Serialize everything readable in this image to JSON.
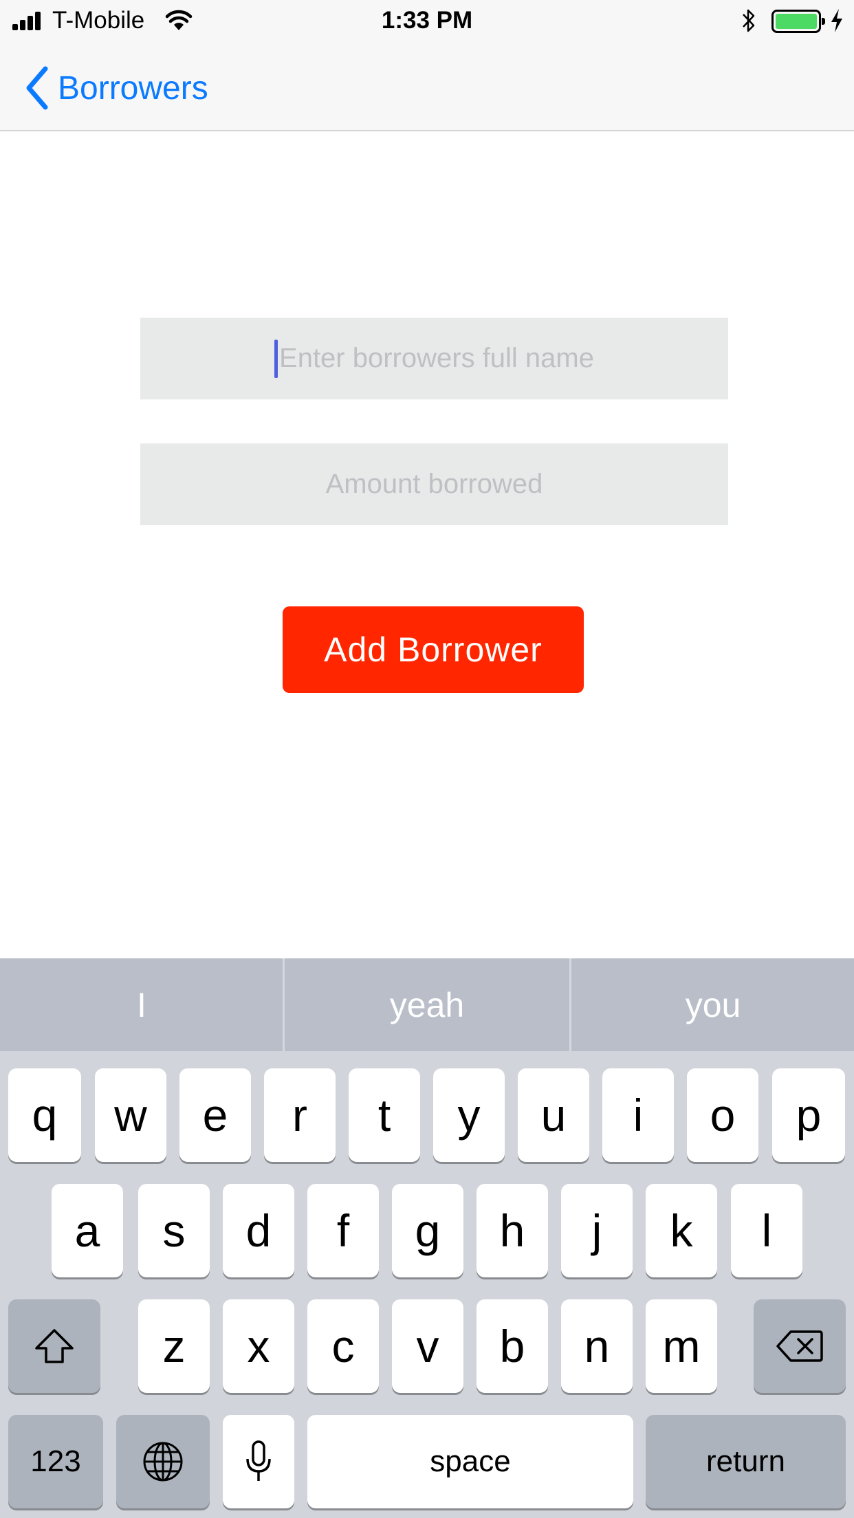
{
  "status_bar": {
    "carrier": "T-Mobile",
    "time": "1:33 PM"
  },
  "nav": {
    "back_label": "Borrowers"
  },
  "form": {
    "name_placeholder": "Enter borrowers full name",
    "amount_placeholder": "Amount borrowed",
    "submit_label": "Add Borrower"
  },
  "keyboard": {
    "suggestions": [
      "I",
      "yeah",
      "you"
    ],
    "row1": [
      "q",
      "w",
      "e",
      "r",
      "t",
      "y",
      "u",
      "i",
      "o",
      "p"
    ],
    "row2": [
      "a",
      "s",
      "d",
      "f",
      "g",
      "h",
      "j",
      "k",
      "l"
    ],
    "row3": [
      "z",
      "x",
      "c",
      "v",
      "b",
      "n",
      "m"
    ],
    "numbers_label": "123",
    "space_label": "space",
    "return_label": "return"
  },
  "colors": {
    "accent": "#0a7aff",
    "button": "#ff2600",
    "battery": "#4cd964"
  },
  "icons": [
    "signal-icon",
    "wifi-icon",
    "bluetooth-icon",
    "battery-icon",
    "charging-icon",
    "chevron-left-icon",
    "shift-icon",
    "delete-icon",
    "globe-icon",
    "microphone-icon"
  ]
}
